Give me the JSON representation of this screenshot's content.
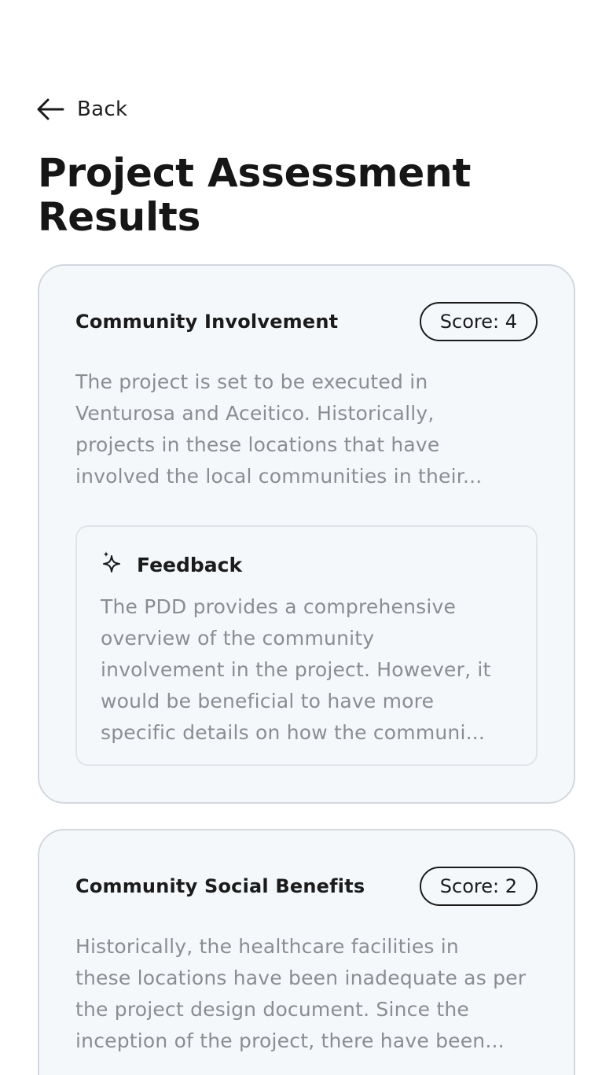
{
  "nav": {
    "back_label": "Back"
  },
  "page": {
    "title": "Project Assessment Results"
  },
  "assessments": [
    {
      "title": "Community Involvement",
      "score_label": "Score: 4",
      "summary_lines": [
        "The project is set to be executed in",
        "Venturosa and Aceitico. Historically,",
        "projects in these locations that have",
        "involved the local communities in their..."
      ],
      "feedback": {
        "title": "Feedback",
        "icon": "sparkle-icon",
        "lines": [
          "The PDD provides a comprehensive",
          "overview of the community",
          "involvement in the project. However, it",
          "would be beneficial to have more",
          "specific details on how the communi..."
        ]
      }
    },
    {
      "title": "Community Social Benefits",
      "score_label": "Score: 2",
      "summary_lines": [
        "Historically, the healthcare facilities in",
        "these locations have been inadequate as per",
        "the project design document. Since the",
        "inception of the project, there have been..."
      ]
    }
  ],
  "colors": {
    "card_bg": "#f5f8fb",
    "card_border": "#d3d8df",
    "muted_text": "#8a8d92",
    "heading_text": "#161616"
  }
}
